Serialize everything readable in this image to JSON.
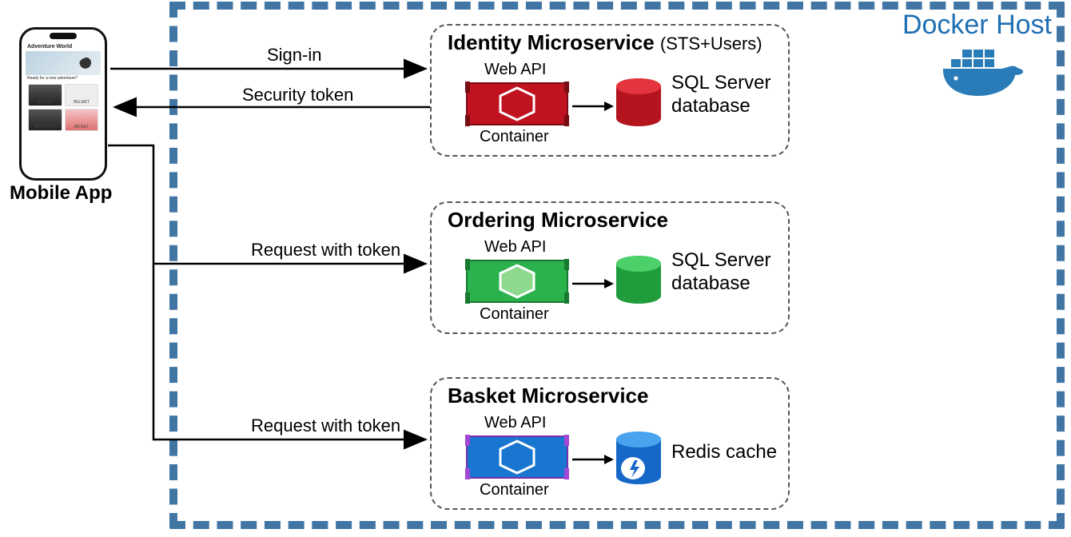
{
  "docker_host_label": "Docker Host",
  "mobile_app_label": "Mobile App",
  "phone": {
    "brand": "Adventure World",
    "hero_caption": "Ready for a new adventure?",
    "items": [
      "ADIDAS",
      "HELMET",
      "BACKPACK",
      "JACKET"
    ]
  },
  "connectors": {
    "signin": "Sign-in",
    "security_token": "Security token",
    "request_with_token_1": "Request with token",
    "request_with_token_2": "Request with token"
  },
  "microservices": {
    "identity": {
      "title": "Identity Microservice",
      "subtitle": "(STS+Users)",
      "webapi": "Web API",
      "container": "Container",
      "db_label": "SQL Server database",
      "color": "#c1121f"
    },
    "ordering": {
      "title": "Ordering Microservice",
      "subtitle": "",
      "webapi": "Web API",
      "container": "Container",
      "db_label": "SQL Server database",
      "color": "#2bb24c"
    },
    "basket": {
      "title": "Basket Microservice",
      "subtitle": "",
      "webapi": "Web API",
      "container": "Container",
      "db_label": "Redis cache",
      "color": "#1876d1"
    }
  }
}
